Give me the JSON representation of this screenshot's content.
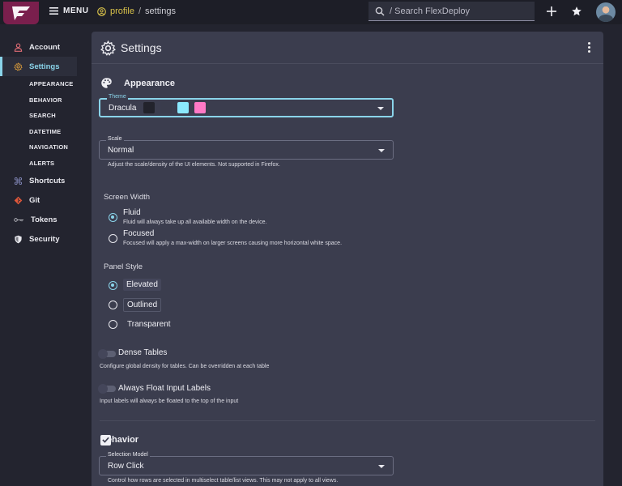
{
  "topbar": {
    "menu_label": "MENU",
    "breadcrumb_home": "profile",
    "breadcrumb_sep": "/",
    "breadcrumb_current": "settings",
    "search_placeholder": "/ Search FlexDeploy"
  },
  "sidebar": {
    "items": [
      {
        "label": "Account",
        "icon": "user-icon"
      },
      {
        "label": "Settings",
        "icon": "gear-icon",
        "active": true
      },
      {
        "label": "Shortcuts",
        "icon": "command-icon"
      },
      {
        "label": "Git",
        "icon": "git-icon"
      },
      {
        "label": "Tokens",
        "icon": "key-icon"
      },
      {
        "label": "Security",
        "icon": "shield-icon"
      }
    ],
    "subitems": [
      "APPEARANCE",
      "BEHAVIOR",
      "SEARCH",
      "DATETIME",
      "NAVIGATION",
      "ALERTS"
    ]
  },
  "panel": {
    "title": "Settings"
  },
  "appearance": {
    "title": "Appearance",
    "theme": {
      "label": "Theme",
      "value": "Dracula",
      "swatches": [
        "#22232c",
        "#3a3c4c",
        "#8be9fd",
        "#ff79c6"
      ]
    },
    "scale": {
      "label": "Scale",
      "value": "Normal",
      "hint": "Adjust the scale/density of the UI elements. Not supported in Firefox."
    },
    "screen_width": {
      "label": "Screen Width",
      "options": [
        {
          "label": "Fluid",
          "desc": "Fluid will always take up all available width on the device.",
          "selected": true
        },
        {
          "label": "Focused",
          "desc": "Focused will apply a max-width on larger screens causing more horizontal white space.",
          "selected": false
        }
      ]
    },
    "panel_style": {
      "label": "Panel Style",
      "options": [
        {
          "label": "Elevated",
          "selected": true
        },
        {
          "label": "Outlined",
          "selected": false
        },
        {
          "label": "Transparent",
          "selected": false
        }
      ]
    },
    "dense_tables": {
      "label": "Dense Tables",
      "hint": "Configure global density for tables. Can be overridden at each table",
      "on": false
    },
    "float_labels": {
      "label": "Always Float Input Labels",
      "hint": "Input labels will always be floated to the top of the input",
      "on": false
    }
  },
  "behavior": {
    "title": "Behavior",
    "selection_model": {
      "label": "Selection Model",
      "value": "Row Click",
      "hint": "Control how rows are selected in multiselect table/list views. This may not apply to all views."
    }
  },
  "colors": {
    "accent": "#8ad4ea",
    "brand": "#7a1f4d",
    "panel": "#3b3d4e",
    "background": "#23242f"
  }
}
